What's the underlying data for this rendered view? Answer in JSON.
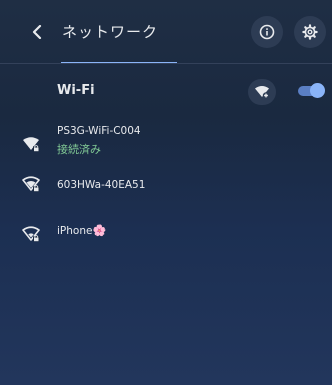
{
  "header": {
    "title": "ネットワーク",
    "back_icon": "chevron-left-icon",
    "info_icon": "info-icon",
    "settings_icon": "gear-icon"
  },
  "wifi": {
    "title": "Wi-Fi",
    "add_icon": "add-wifi-icon",
    "enabled": true
  },
  "networks": [
    {
      "name": "PS3G-WiFi-C004",
      "status": "接続済み",
      "icon": "wifi-lock-icon"
    },
    {
      "name": "603HWa-40EA51",
      "icon": "wifi-lock-icon"
    },
    {
      "name": "iPhone",
      "suffix": "🌸",
      "icon": "wifi-lock-icon"
    }
  ],
  "colors": {
    "accent": "#8ab4f8",
    "connected": "#81c995",
    "background": "#1f2e44"
  }
}
